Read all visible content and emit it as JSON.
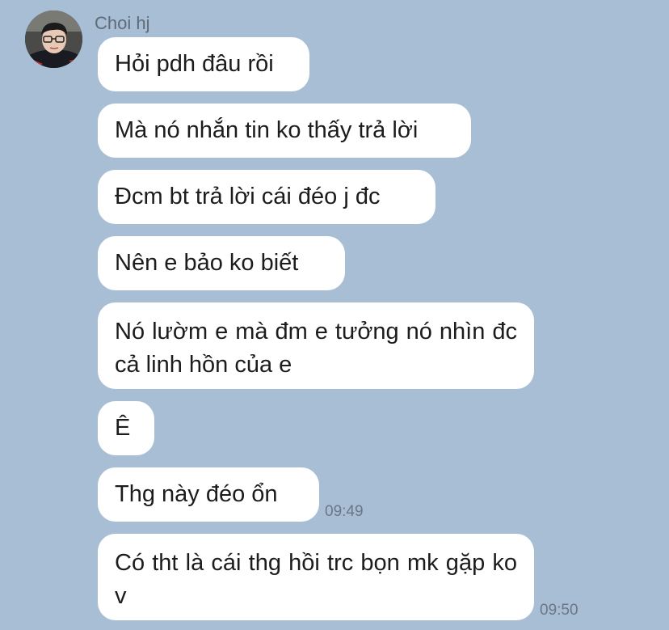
{
  "sender": {
    "name": "Choi hj"
  },
  "messages": [
    {
      "text": "Hỏi pdh đâu rồi",
      "time": ""
    },
    {
      "text": "Mà nó nhắn tin ko thấy trả lời",
      "time": ""
    },
    {
      "text": "Đcm bt trả lời cái đéo j đc",
      "time": ""
    },
    {
      "text": "Nên e bảo ko biết",
      "time": ""
    },
    {
      "text": "Nó lườm e mà đm e tưởng nó nhìn đc cả linh hồn của e",
      "time": ""
    },
    {
      "text": "Ê",
      "time": ""
    },
    {
      "text": "Thg này đéo ổn",
      "time": "09:49"
    },
    {
      "text": "Có tht là cái thg hồi trc bọn mk gặp ko v",
      "time": "09:50"
    }
  ],
  "colors": {
    "background": "#a8bed4",
    "bubble": "#ffffff",
    "text": "#1c1c1c",
    "meta": "#6b7786"
  }
}
